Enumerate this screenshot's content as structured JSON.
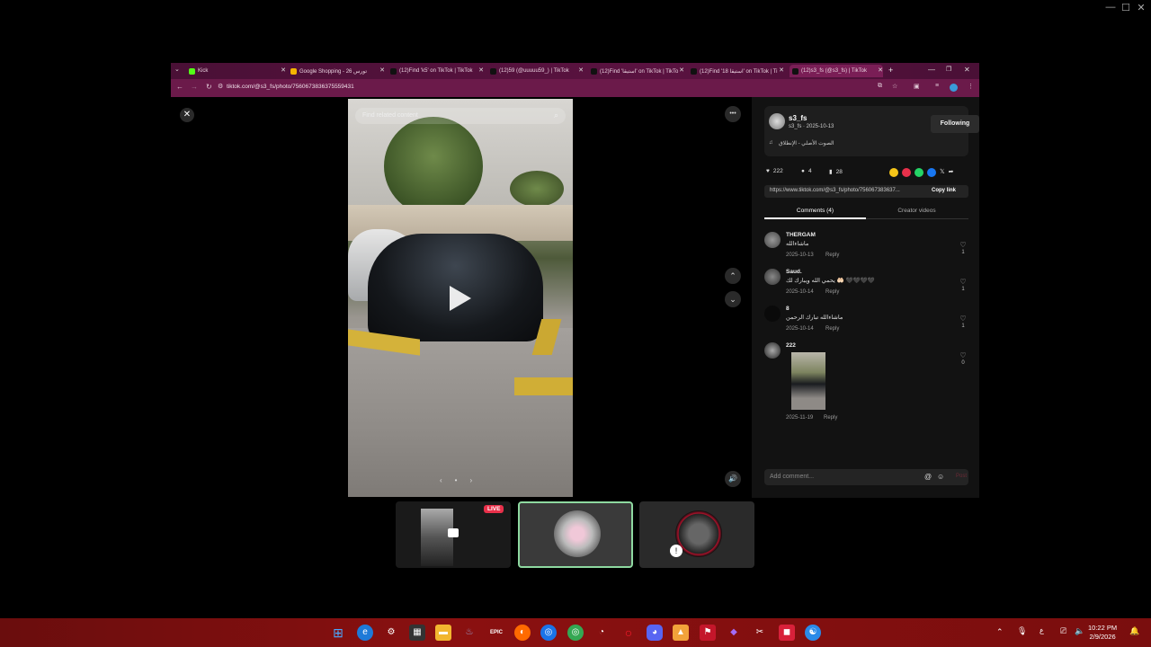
{
  "browser": {
    "tabs": [
      {
        "label": "Kick"
      },
      {
        "label": "Google Shopping - 26 تورس"
      },
      {
        "label": "(12)Find 'k5' on TikTok | TikTok"
      },
      {
        "label": "(12)59 (@uuuuu59_) | TikTok"
      },
      {
        "label": "(12)Find 'استيقا' on TikTok | TikTo"
      },
      {
        "label": "(12)Find '18 استيقا' on TikTok | Ti"
      },
      {
        "label": "(12)s3_fs (@s3_fs) | TikTok"
      }
    ],
    "new_tab": "+",
    "url": "tiktok.com/@s3_fs/photo/7560673836375559431"
  },
  "viewer": {
    "search_placeholder": "Find related content",
    "more": "•••",
    "close": "✕"
  },
  "post": {
    "username": "s3_fs",
    "meta": "s3_fs · 2025-10-13",
    "follow_label": "Following",
    "music": "الصوت الأصلي - الإنطلاق",
    "likes": "222",
    "comments_count": "4",
    "saves": "28",
    "link": "https://www.tiktok.com/@s3_fs/photo/756067383637...",
    "copy_link": "Copy link",
    "tab_comments": "Comments (4)",
    "tab_creator": "Creator videos",
    "comments": [
      {
        "name": "THERGAM",
        "text": "ماشاءالله",
        "date": "2025-10-13",
        "reply": "Reply",
        "likes": "1"
      },
      {
        "name": "Saud.",
        "text": "يحمي الله ويبارك لك 🤲🏻 🖤🖤🖤🖤",
        "date": "2025-10-14",
        "reply": "Reply",
        "likes": "1"
      },
      {
        "name": "8",
        "text": "ماشاءالله تبارك الرحمن",
        "date": "2025-10-14",
        "reply": "Reply",
        "likes": "1"
      },
      {
        "name": "222",
        "text": "",
        "date": "2025-11-19",
        "reply": "Reply",
        "likes": "0"
      }
    ],
    "add_comment": "Add comment...",
    "post_label": "Post"
  },
  "thumbs": {
    "live": "LIVE"
  },
  "taskbar": {
    "time": "10:22 PM",
    "date": "2/9/2026"
  },
  "colors": {
    "tab_bar": "#5a1240",
    "taskbar": "#8a1010",
    "live": "#e8304a"
  }
}
